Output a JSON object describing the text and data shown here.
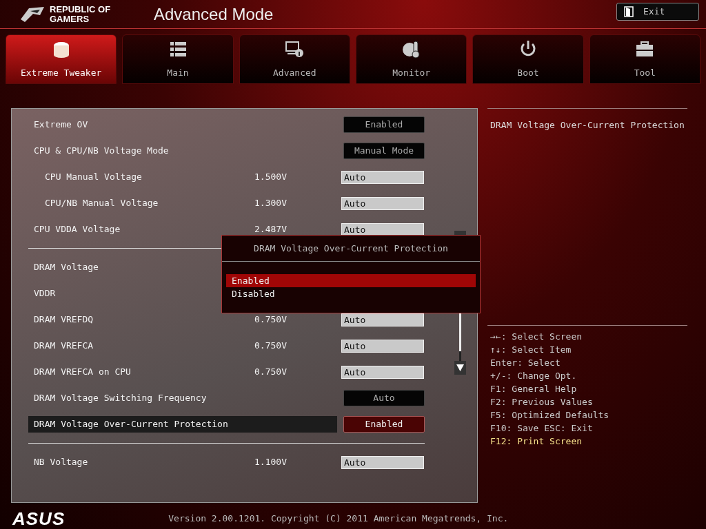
{
  "header": {
    "brand": "REPUBLIC OF GAMERS",
    "title": "Advanced Mode",
    "exit_button": "Exit"
  },
  "tabs": [
    {
      "label": "Extreme Tweaker",
      "selected": true
    },
    {
      "label": "Main",
      "selected": false
    },
    {
      "label": "Advanced",
      "selected": false
    },
    {
      "label": "Monitor",
      "selected": false
    },
    {
      "label": "Boot",
      "selected": false
    },
    {
      "label": "Tool",
      "selected": false
    }
  ],
  "settings": [
    [
      {
        "label": "Extreme OV",
        "kind": "button",
        "value": "Enabled",
        "selected": false
      },
      {
        "label": "CPU & CPU/NB Voltage Mode",
        "kind": "button",
        "value": "Manual Mode",
        "selected": false,
        "children": [
          {
            "label": "CPU Manual Voltage",
            "kind": "field",
            "reading": "1.500V",
            "value": "Auto",
            "selected": false
          },
          {
            "label": "CPU/NB Manual Voltage",
            "kind": "field",
            "reading": "1.300V",
            "value": "Auto",
            "selected": false
          }
        ]
      },
      {
        "label": "CPU VDDA Voltage",
        "kind": "field",
        "reading": "2.487V",
        "value": "Auto",
        "selected": false
      }
    ],
    [
      {
        "label": "DRAM Voltage",
        "kind": "hidden",
        "selected": false
      },
      {
        "label": "VDDR",
        "kind": "hidden",
        "selected": false
      },
      {
        "label": "DRAM VREFDQ",
        "kind": "field",
        "reading": "0.750V",
        "value": "Auto",
        "selected": false
      },
      {
        "label": "DRAM VREFCA",
        "kind": "field",
        "reading": "0.750V",
        "value": "Auto",
        "selected": false
      },
      {
        "label": "DRAM VREFCA on CPU",
        "kind": "field",
        "reading": "0.750V",
        "value": "Auto",
        "selected": false
      },
      {
        "label": "DRAM Voltage Switching Frequency",
        "kind": "button",
        "value": "Auto",
        "selected": false
      },
      {
        "label": "DRAM Voltage Over-Current Protection",
        "kind": "button",
        "value": "Enabled",
        "selected": true
      }
    ],
    [
      {
        "label": "NB Voltage",
        "kind": "field",
        "reading": "1.100V",
        "value": "Auto",
        "selected": false
      }
    ]
  ],
  "popup": {
    "title": "DRAM Voltage Over-Current Protection",
    "options": [
      {
        "label": "Enabled",
        "selected": true
      },
      {
        "label": "Disabled",
        "selected": false
      }
    ]
  },
  "help": {
    "description": "DRAM Voltage Over-Current Protection",
    "keys": [
      {
        "text": "→←: Select Screen",
        "highlight": false
      },
      {
        "text": "↑↓: Select Item",
        "highlight": false
      },
      {
        "text": "Enter: Select",
        "highlight": false
      },
      {
        "text": "+/-: Change Opt.",
        "highlight": false
      },
      {
        "text": "F1: General Help",
        "highlight": false
      },
      {
        "text": "F2: Previous Values",
        "highlight": false
      },
      {
        "text": "F5: Optimized Defaults",
        "highlight": false
      },
      {
        "text": "F10: Save  ESC: Exit",
        "highlight": false
      },
      {
        "text": "F12: Print Screen",
        "highlight": true
      }
    ]
  },
  "footer": {
    "logo": "ASUS",
    "version": "Version 2.00.1201. Copyright (C) 2011 American Megatrends, Inc."
  }
}
